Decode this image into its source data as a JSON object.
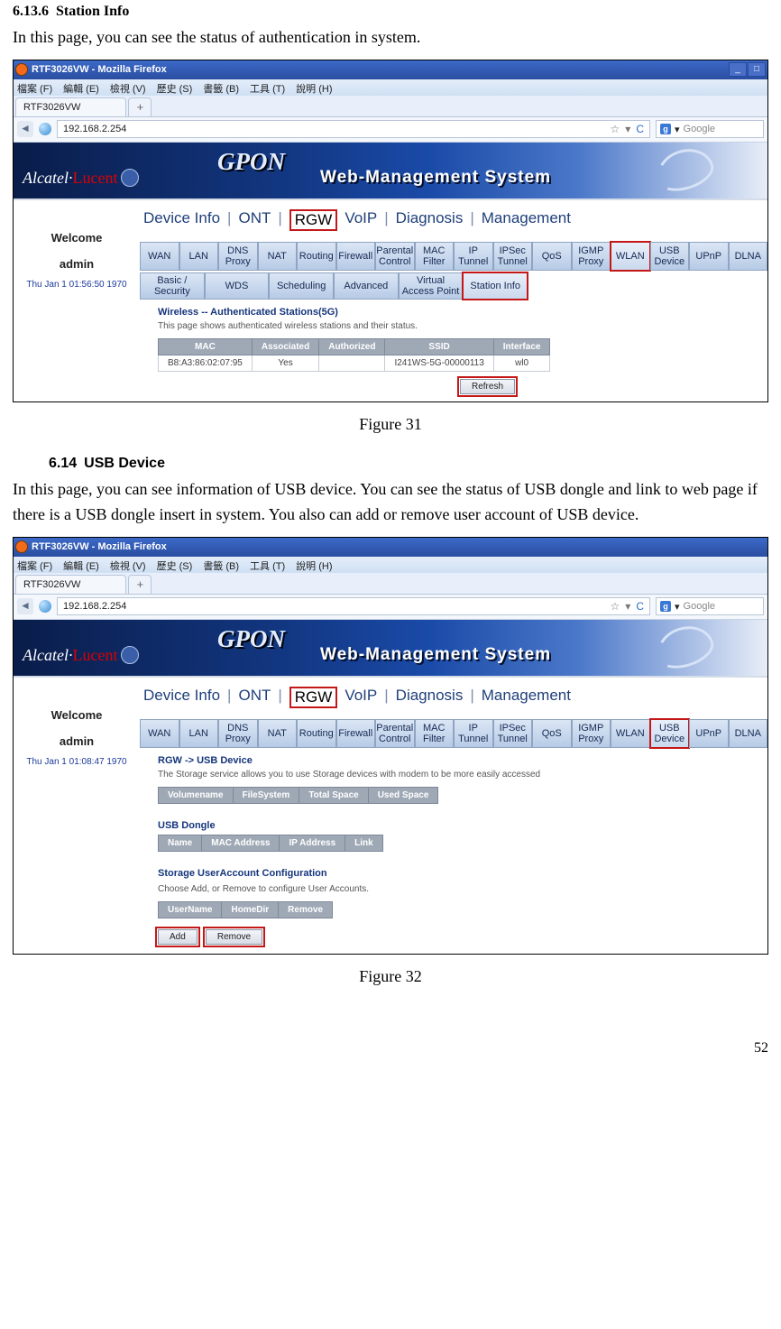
{
  "section1": {
    "num": "6.13.6",
    "title": "Station Info"
  },
  "para1": "In this page, you can see the status of authentication in system.",
  "fig1_caption": "Figure 31",
  "section2": {
    "num": "6.14",
    "title": "USB Device"
  },
  "para2": "In this page, you can see information of USB device. You can see the status of USB dongle and link to web page if there is a USB dongle insert in system. You also can add or remove user account of USB device.",
  "fig2_caption": "Figure 32",
  "page_number": "52",
  "browser": {
    "window_title": "RTF3026VW - Mozilla Firefox",
    "menus": [
      "檔案 (F)",
      "編輯 (E)",
      "檢視 (V)",
      "歷史 (S)",
      "書籤 (B)",
      "工具 (T)",
      "說明 (H)"
    ],
    "tab_label": "RTF3026VW",
    "url": "192.168.2.254",
    "search_placeholder": "Google"
  },
  "banner": {
    "brand1": "Alcatel·",
    "brand2": "Lucent",
    "gpon": "GPON",
    "wms": "Web-Management System"
  },
  "sidebar": {
    "welcome": "Welcome",
    "user": "admin",
    "dt1": "Thu Jan 1 01:56:50 1970",
    "dt2": "Thu Jan 1 01:08:47 1970"
  },
  "primary_nav": [
    "Device Info",
    "ONT",
    "RGW",
    "VoIP",
    "Diagnosis",
    "Management"
  ],
  "primary_nav_selected_index": 2,
  "tabs_row1": [
    "WAN",
    "LAN",
    "DNS Proxy",
    "NAT",
    "Routing",
    "Firewall",
    "Parental Control",
    "MAC Filter",
    "IP Tunnel",
    "IPSec Tunnel",
    "QoS",
    "IGMP Proxy",
    "WLAN",
    "USB Device",
    "UPnP",
    "DLNA"
  ],
  "shot1": {
    "tabs_row1_selected_index": 12,
    "tabs_row2": [
      "Basic / Security",
      "WDS",
      "Scheduling",
      "Advanced",
      "Virtual Access Point",
      "Station Info"
    ],
    "tabs_row2_selected_index": 5,
    "crumbs": "Wireless -- Authenticated Stations(5G)",
    "desc": "This page shows authenticated wireless stations and their status.",
    "tbl_headers": [
      "MAC",
      "Associated",
      "Authorized",
      "SSID",
      "Interface"
    ],
    "tbl_row": [
      "B8:A3:86:02:07:95",
      "Yes",
      "",
      "I241WS-5G-00000113",
      "wl0"
    ],
    "refresh": "Refresh"
  },
  "shot2": {
    "tabs_row1_selected_index": 13,
    "crumbs": "RGW -> USB Device",
    "desc": "The Storage service allows you to use Storage devices with modem to be more easily accessed",
    "storage_headers": [
      "Volumename",
      "FileSystem",
      "Total Space",
      "Used Space"
    ],
    "dongle_title": "USB Dongle",
    "dongle_headers": [
      "Name",
      "MAC Address",
      "IP Address",
      "Link"
    ],
    "ua_title": "Storage UserAccount Configuration",
    "ua_desc": "Choose Add, or Remove to configure User Accounts.",
    "ua_headers": [
      "UserName",
      "HomeDir",
      "Remove"
    ],
    "btn_add": "Add",
    "btn_remove": "Remove"
  }
}
